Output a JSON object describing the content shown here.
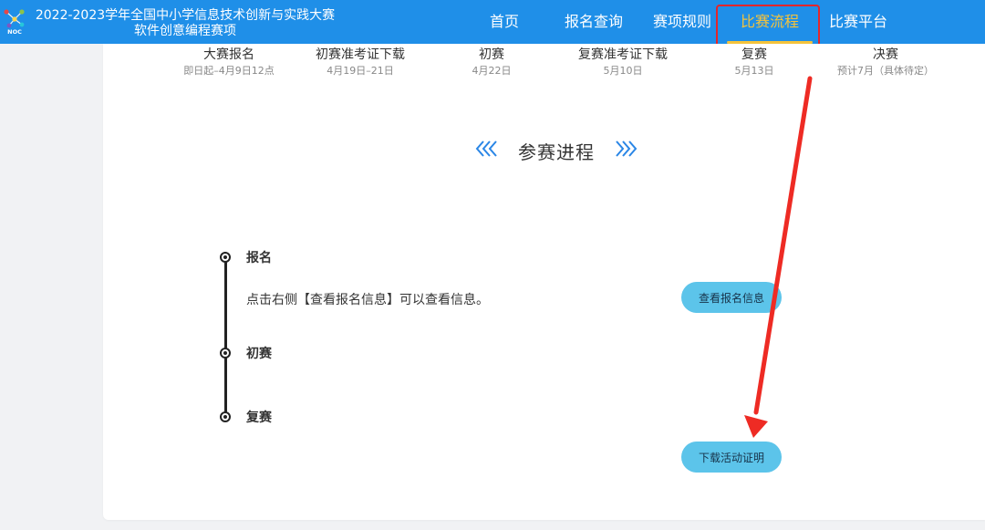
{
  "header": {
    "title_line1": "2022-2023学年全国中小学信息技术创新与实践大赛",
    "title_line2": "软件创意编程赛项",
    "logo_text": "NOC",
    "logo_icon": "noc-molecule-logo",
    "nav": [
      {
        "label": "首页",
        "active": false
      },
      {
        "label": "报名查询",
        "active": false
      },
      {
        "label": "赛项规则",
        "active": false
      },
      {
        "label": "比赛流程",
        "active": true
      },
      {
        "label": "比赛平台",
        "active": false
      }
    ],
    "active_color": "#f5c33b",
    "background_color": "#1f8fe8"
  },
  "stages": [
    {
      "name": "大赛报名",
      "date": "即日起–4月9日12点"
    },
    {
      "name": "初赛准考证下载",
      "date": "4月19日–21日"
    },
    {
      "name": "初赛",
      "date": "4月22日"
    },
    {
      "name": "复赛准考证下载",
      "date": "5月10日"
    },
    {
      "name": "复赛",
      "date": "5月13日"
    },
    {
      "name": "决赛",
      "date": "预计7月（具体待定）"
    }
  ],
  "section": {
    "title": "参赛进程",
    "left_chevrons": "«",
    "right_chevrons": "»",
    "chevron_color": "#2a86e6"
  },
  "timeline": {
    "steps": [
      {
        "label": "报名",
        "description": "点击右侧【查看报名信息】可以查看信息。"
      },
      {
        "label": "初赛",
        "description": ""
      },
      {
        "label": "复赛",
        "description": ""
      }
    ],
    "buttons": {
      "view_registration": "查看报名信息",
      "download_certificate": "下载活动证明"
    },
    "button_color": "#5cc4ea"
  },
  "annotation": {
    "highlight_color": "#e4262a"
  }
}
